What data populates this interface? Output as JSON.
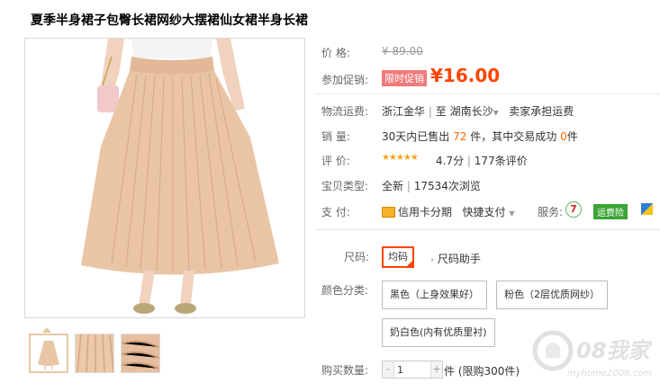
{
  "product": {
    "title": "夏季半身裙子包臀长裙网纱大摆裙仙女裙半身长裙"
  },
  "price": {
    "label": "价 格:",
    "original": "¥ 89.00",
    "promo_label": "参加促销:",
    "promo_tag": "限时促销",
    "promo_price": "¥16.00"
  },
  "shipping": {
    "label": "物流运费:",
    "from": "浙江金华",
    "separator": "|",
    "to_prefix": "至",
    "to_city": "湖南长沙",
    "fee": "卖家承担运费"
  },
  "sales": {
    "label": "销 量:",
    "prefix": "30天内已售出",
    "sold": "72",
    "mid": "件，其中交易成功",
    "success": "0",
    "suffix": "件"
  },
  "rating": {
    "label": "评 价:",
    "stars": "★★★★★",
    "score": "4.7分",
    "sep": "|",
    "reviews": "177条评价"
  },
  "item_type": {
    "label": "宝贝类型:",
    "condition": "全新",
    "sep": "|",
    "views": "17534次浏览"
  },
  "payment": {
    "label": "支 付:",
    "credit": "信用卡分期",
    "quick": "快捷支付",
    "service_label": "服务:",
    "service_seven": "7",
    "service_tag": "运费险"
  },
  "size": {
    "label": "尺码:",
    "selected": "均码",
    "helper": "尺码助手"
  },
  "color": {
    "label": "颜色分类:",
    "options": [
      "黑色（上身效果好）",
      "粉色（2层优质网纱）",
      "奶白色(内有优质里衬)"
    ]
  },
  "quantity": {
    "label": "购买数量:",
    "minus": "-",
    "value": "1",
    "plus": "+",
    "unit": "件 (限购300件)"
  },
  "watermark": {
    "brand": "08我家",
    "url": "myhome2008.com"
  },
  "colors": {
    "accent": "#ff4400",
    "promo_tag_bg": "#f07a7a",
    "stars": "#f7a21b",
    "service_green": "#3aa534",
    "skirt": "#e9c5a5"
  }
}
